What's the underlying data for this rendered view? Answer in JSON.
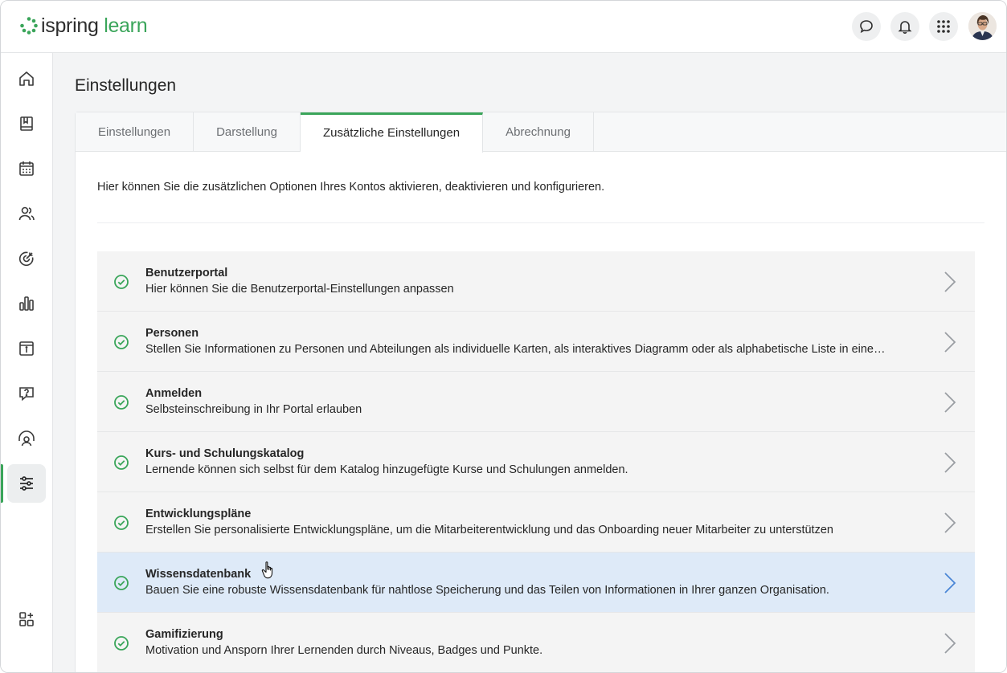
{
  "header": {
    "logo": {
      "brand": "ispring",
      "product": "learn"
    },
    "buttons": [
      {
        "name": "chat",
        "icon": "chat-bubble-icon"
      },
      {
        "name": "notifications",
        "icon": "bell-icon"
      },
      {
        "name": "apps",
        "icon": "grid-icon"
      }
    ],
    "avatar_icon": "user-avatar"
  },
  "sidebar": {
    "items": [
      {
        "name": "home",
        "icon": "home-icon"
      },
      {
        "name": "courses",
        "icon": "book-icon"
      },
      {
        "name": "calendar",
        "icon": "calendar-icon"
      },
      {
        "name": "users",
        "icon": "users-icon"
      },
      {
        "name": "goals",
        "icon": "target-icon"
      },
      {
        "name": "reports",
        "icon": "bar-chart-icon"
      },
      {
        "name": "info",
        "icon": "info-board-icon"
      },
      {
        "name": "help",
        "icon": "question-bubble-icon"
      },
      {
        "name": "support",
        "icon": "headset-icon"
      },
      {
        "name": "settings",
        "icon": "sliders-icon",
        "active": true
      }
    ],
    "bottom_item": {
      "name": "add-apps",
      "icon": "add-apps-icon"
    }
  },
  "page": {
    "title": "Einstellungen",
    "tabs": [
      {
        "label": "Einstellungen",
        "active": false
      },
      {
        "label": "Darstellung",
        "active": false
      },
      {
        "label": "Zusätzliche Einstellungen",
        "active": true
      },
      {
        "label": "Abrechnung",
        "active": false
      }
    ],
    "intro": "Hier können Sie die zusätzlichen Optionen Ihres Kontos aktivieren, deaktivieren und konfigurieren.",
    "options": [
      {
        "title": "Benutzerportal",
        "description": "Hier können Sie die Benutzerportal-Einstellungen anpassen",
        "enabled": true
      },
      {
        "title": "Personen",
        "description": "Stellen Sie Informationen zu Personen und Abteilungen als individuelle Karten, als interaktives Diagramm oder als alphabetische Liste in eine…",
        "enabled": true
      },
      {
        "title": "Anmelden",
        "description": "Selbsteinschreibung in Ihr Portal erlauben",
        "enabled": true
      },
      {
        "title": "Kurs- und Schulungskatalog",
        "description": "Lernende können sich selbst für dem Katalog hinzugefügte Kurse und Schulungen anmelden.",
        "enabled": true
      },
      {
        "title": "Entwicklungspläne",
        "description": "Erstellen Sie personalisierte Entwicklungspläne, um die Mitarbeiterentwicklung und das Onboarding neuer Mitarbeiter zu unterstützen",
        "enabled": true
      },
      {
        "title": "Wissensdatenbank",
        "description": "Bauen Sie eine robuste Wissensdatenbank für nahtlose Speicherung und das Teilen von Informationen in Ihrer ganzen Organisation.",
        "enabled": true,
        "hovered": true
      },
      {
        "title": "Gamifizierung",
        "description": "Motivation und Ansporn Ihrer Lernenden durch Niveaus, Badges und Punkte.",
        "enabled": true
      }
    ]
  },
  "colors": {
    "accent": "#3aa55a",
    "hover_row": "#deeaf8",
    "chevron": "#9a9ea3",
    "chevron_hover": "#4a86d6"
  }
}
